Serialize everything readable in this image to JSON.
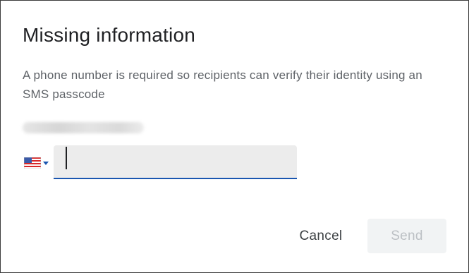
{
  "dialog": {
    "title": "Missing information",
    "description": "A phone number is required so recipients can verify their identity using an SMS passcode"
  },
  "recipient": {
    "email_redacted": true
  },
  "phone": {
    "country_flag": "us-flag-icon",
    "value": "",
    "focused": true
  },
  "actions": {
    "cancel_label": "Cancel",
    "send_label": "Send",
    "send_enabled": false
  },
  "colors": {
    "title": "#202124",
    "body_text": "#5f6368",
    "field_underline": "#1a56b0",
    "field_bg": "#ececec",
    "send_bg": "#f1f3f4",
    "send_text": "#bcc0c4"
  }
}
